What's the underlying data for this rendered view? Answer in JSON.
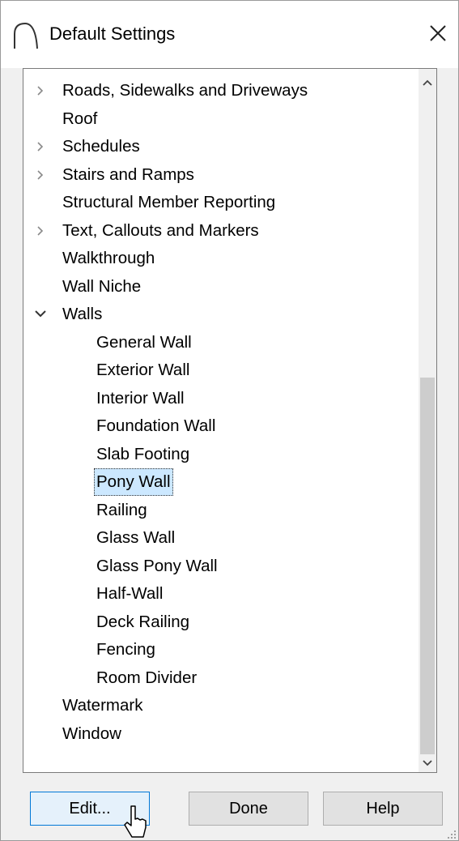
{
  "window": {
    "title": "Default Settings",
    "close_glyph": "✕"
  },
  "tree": {
    "items": [
      {
        "label": "Roads, Sidewalks and Driveways",
        "level": 0,
        "expander": "collapsed"
      },
      {
        "label": "Roof",
        "level": 0,
        "expander": "none"
      },
      {
        "label": "Schedules",
        "level": 0,
        "expander": "collapsed"
      },
      {
        "label": "Stairs and Ramps",
        "level": 0,
        "expander": "collapsed"
      },
      {
        "label": "Structural Member Reporting",
        "level": 0,
        "expander": "none"
      },
      {
        "label": "Text, Callouts and Markers",
        "level": 0,
        "expander": "collapsed"
      },
      {
        "label": "Walkthrough",
        "level": 0,
        "expander": "none"
      },
      {
        "label": "Wall Niche",
        "level": 0,
        "expander": "none"
      },
      {
        "label": "Walls",
        "level": 0,
        "expander": "expanded"
      },
      {
        "label": "General Wall",
        "level": 1,
        "expander": "none"
      },
      {
        "label": "Exterior Wall",
        "level": 1,
        "expander": "none"
      },
      {
        "label": "Interior Wall",
        "level": 1,
        "expander": "none"
      },
      {
        "label": "Foundation Wall",
        "level": 1,
        "expander": "none"
      },
      {
        "label": "Slab Footing",
        "level": 1,
        "expander": "none"
      },
      {
        "label": "Pony Wall",
        "level": 1,
        "expander": "none",
        "selected": true
      },
      {
        "label": "Railing",
        "level": 1,
        "expander": "none"
      },
      {
        "label": "Glass Wall",
        "level": 1,
        "expander": "none"
      },
      {
        "label": "Glass Pony Wall",
        "level": 1,
        "expander": "none"
      },
      {
        "label": "Half-Wall",
        "level": 1,
        "expander": "none"
      },
      {
        "label": "Deck Railing",
        "level": 1,
        "expander": "none"
      },
      {
        "label": "Fencing",
        "level": 1,
        "expander": "none"
      },
      {
        "label": "Room Divider",
        "level": 1,
        "expander": "none"
      },
      {
        "label": "Watermark",
        "level": 0,
        "expander": "none"
      },
      {
        "label": "Window",
        "level": 0,
        "expander": "none"
      }
    ],
    "glyphs": {
      "collapsed": "〉",
      "expanded": "✓"
    }
  },
  "scrollbar": {
    "up_glyph": "⌃",
    "down_glyph": "⌄"
  },
  "buttons": {
    "edit": "Edit...",
    "done": "Done",
    "help": "Help"
  },
  "icons": {
    "app": "arc-icon",
    "cursor": "mouse-pointer-icon",
    "grip": "resize-grip-icon"
  }
}
